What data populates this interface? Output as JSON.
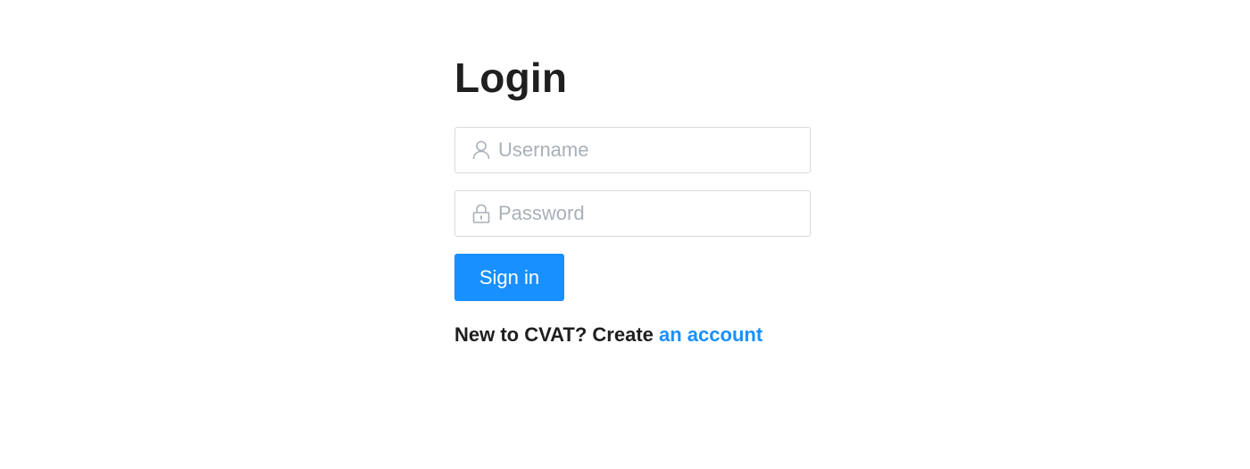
{
  "title": "Login",
  "username": {
    "placeholder": "Username",
    "value": "",
    "icon": "user-icon"
  },
  "password": {
    "placeholder": "Password",
    "value": "",
    "icon": "lock-icon"
  },
  "signin_label": "Sign in",
  "signup": {
    "prompt": "New to CVAT? Create",
    "link_text": "an account"
  },
  "colors": {
    "primary": "#1890ff",
    "text": "#1f1f1f",
    "placeholder": "#a9b0b8",
    "border": "#d9d9d9"
  }
}
